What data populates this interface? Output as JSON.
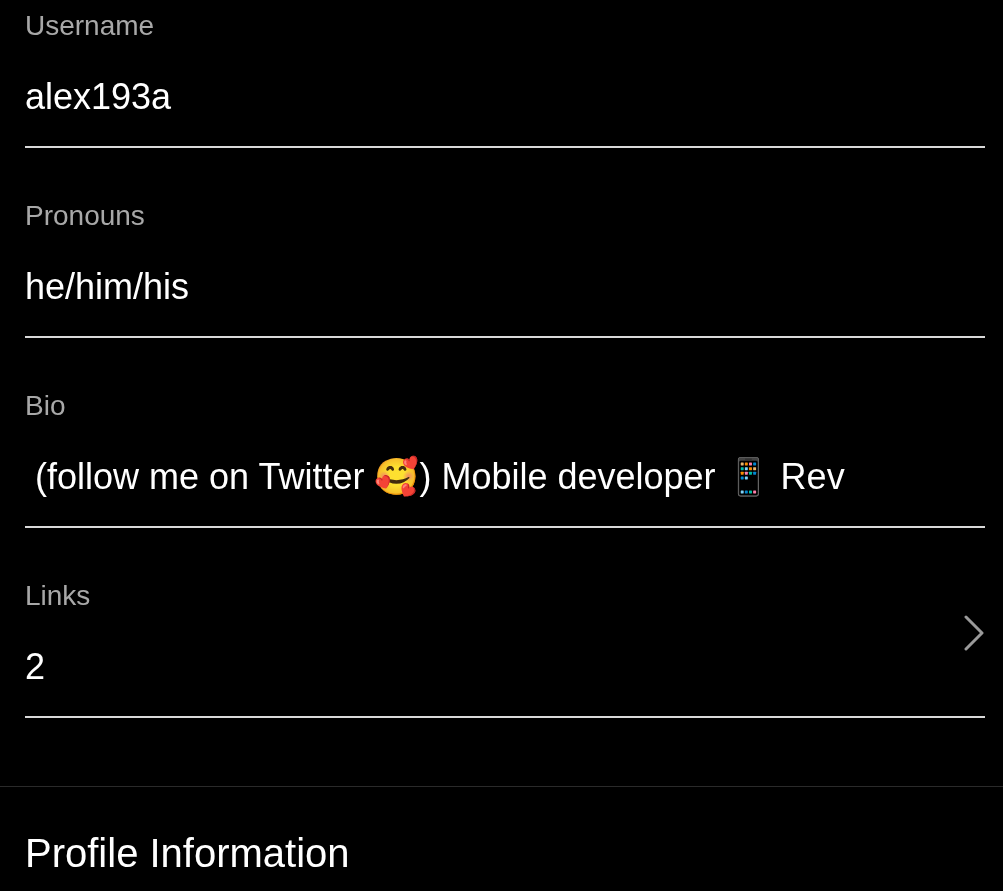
{
  "fields": [
    {
      "kind": "text",
      "label": "Username",
      "value": "alex193a"
    },
    {
      "kind": "text",
      "label": "Pronouns",
      "value": "he/him/his"
    },
    {
      "kind": "text",
      "label": "Bio",
      "value": " (follow me on Twitter 🥰) Mobile developer 📱 Rev"
    },
    {
      "kind": "link",
      "label": "Links",
      "value": "2"
    }
  ],
  "section": {
    "title": "Profile Information"
  }
}
